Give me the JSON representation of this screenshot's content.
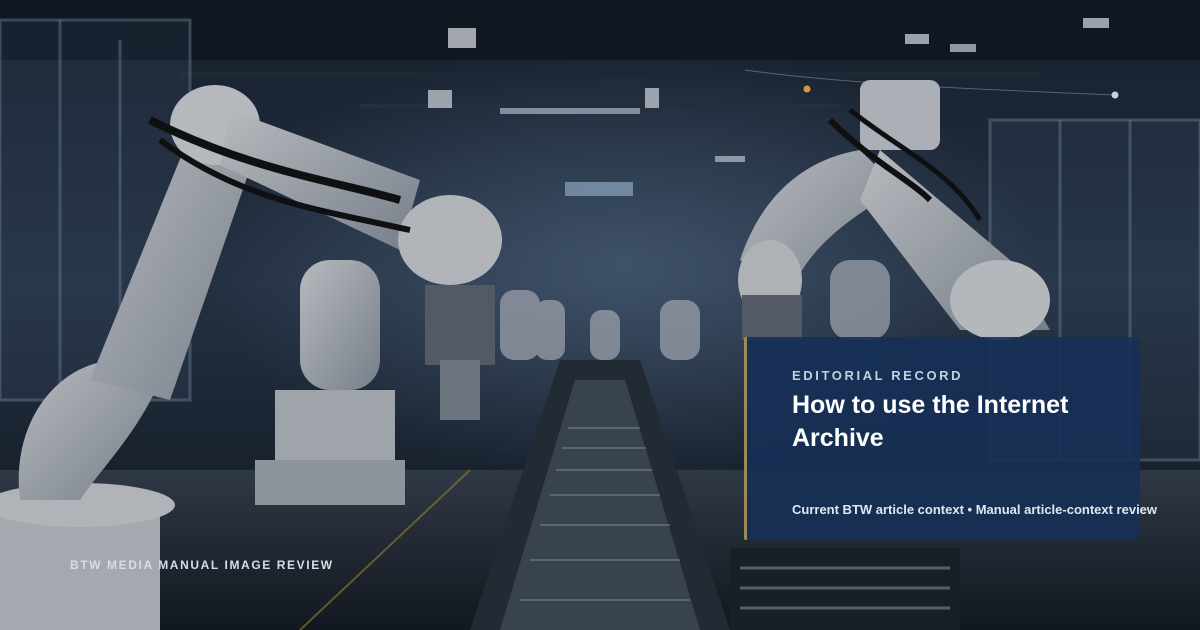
{
  "card": {
    "kicker": "EDITORIAL RECORD",
    "title": "How to use the Internet Archive",
    "meta": "Current BTW article context • Manual article-context review"
  },
  "watermark": "BTW MEDIA MANUAL IMAGE REVIEW",
  "colors": {
    "card_background": "#163056",
    "card_accent": "#9a8c5a",
    "scene_dark": "#0e1622"
  }
}
